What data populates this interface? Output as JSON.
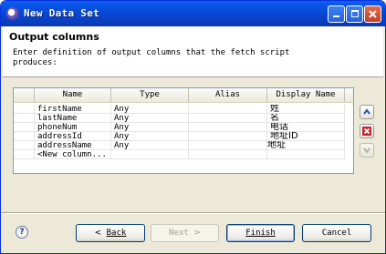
{
  "window": {
    "title": "New Data Set"
  },
  "header": {
    "title": "Output columns",
    "description": "Enter definition of output columns that the fetch script\nproduces:"
  },
  "table": {
    "columns": [
      "Name",
      "Type",
      "Alias",
      "Display Name"
    ],
    "rows": [
      {
        "name": "firstName",
        "type": "Any",
        "alias": "",
        "display": "姓"
      },
      {
        "name": "lastName",
        "type": "Any",
        "alias": "",
        "display": "名"
      },
      {
        "name": "phoneNum",
        "type": "Any",
        "alias": "",
        "display": "电话"
      },
      {
        "name": "addressId",
        "type": "Any",
        "alias": "",
        "display": "地址ID"
      },
      {
        "name": "addressName",
        "type": "Any",
        "alias": "",
        "display": "地址"
      },
      {
        "name": "<New column...",
        "type": "",
        "alias": "",
        "display": ""
      }
    ]
  },
  "side_buttons": {
    "up": "arrow-up-icon",
    "delete": "delete-icon",
    "down": "arrow-down-icon"
  },
  "footer": {
    "help": "?",
    "back": {
      "arrow": "<",
      "label": "Back"
    },
    "next": {
      "label": "Next",
      "arrow": ">"
    },
    "finish": "Finish",
    "cancel": "Cancel"
  },
  "colors": {
    "titlebar": "#0a5ef2",
    "close": "#c3402a",
    "dialog_bg": "#ece9d8"
  }
}
